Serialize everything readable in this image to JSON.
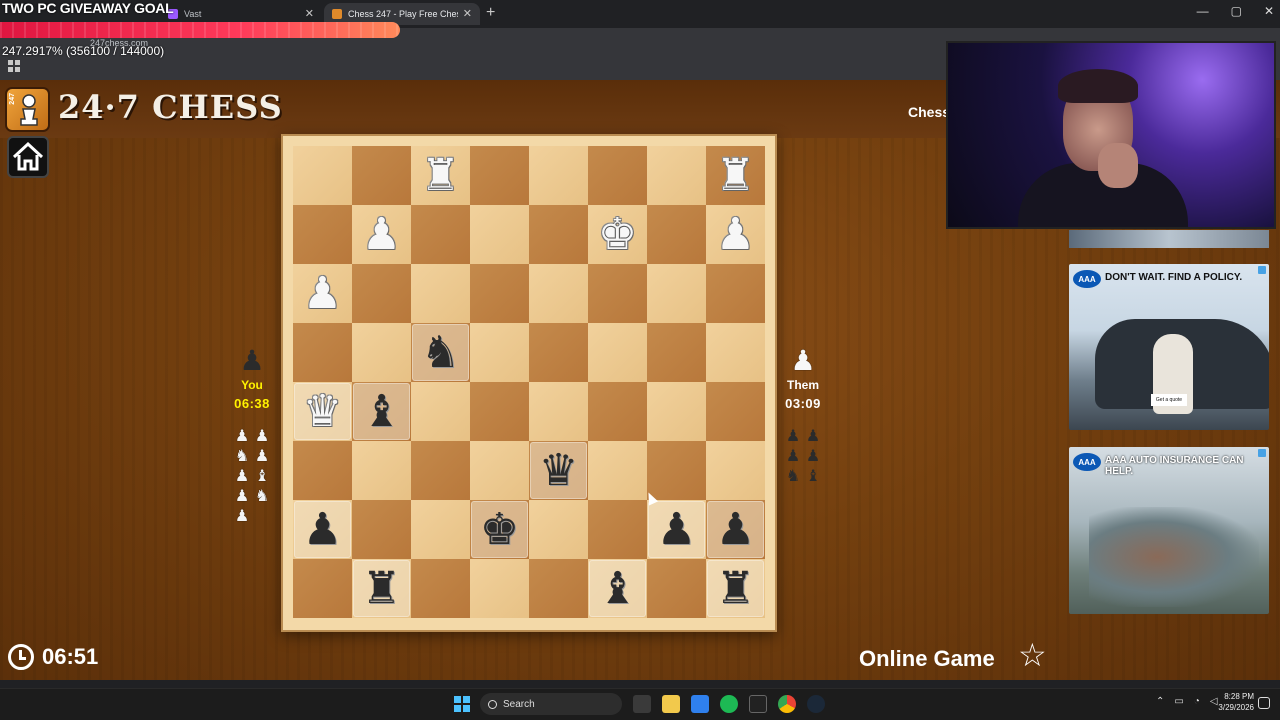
{
  "browser": {
    "tabs": [
      {
        "label": "Vast",
        "active": false
      },
      {
        "label": "Chess 247 - Play Free Chess",
        "active": false
      }
    ],
    "new_tab_label": "+",
    "url": "247chess.com",
    "window_controls": [
      "—",
      "▢",
      "✕"
    ]
  },
  "stream_overlay": {
    "goal_title": "TWO PC GIVEAWAY GOAL",
    "goal_progress": "247.2917% (356100 / 144000)",
    "goal_fraction": 2.472917
  },
  "site": {
    "title": "24·7 CHESS",
    "logo_badge": "247",
    "header_link": "Chess"
  },
  "board": {
    "pieces": [
      [
        "",
        "",
        "♜",
        "",
        "",
        "",
        "",
        "♜"
      ],
      [
        "",
        "♟",
        "",
        "",
        "",
        "♚",
        "",
        "♟"
      ],
      [
        "♟",
        "",
        "",
        "",
        "",
        "",
        "",
        ""
      ],
      [
        "",
        "",
        "♞",
        "",
        "",
        "",
        "",
        ""
      ],
      [
        "♛",
        "♝",
        "",
        "",
        "",
        "",
        "",
        ""
      ],
      [
        "",
        "",
        "",
        "",
        "♛",
        "",
        "",
        ""
      ],
      [
        "♟",
        "",
        "",
        "♚",
        "",
        "",
        "♟",
        "♟"
      ],
      [
        "",
        "♜",
        "",
        "",
        "",
        "♝",
        "",
        "♜"
      ]
    ],
    "colors": [
      [
        "",
        "",
        "w",
        "",
        "",
        "",
        "",
        "w"
      ],
      [
        "",
        "w",
        "",
        "",
        "",
        "w",
        "",
        "w"
      ],
      [
        "w",
        "",
        "",
        "",
        "",
        "",
        "",
        ""
      ],
      [
        "",
        "",
        "b",
        "",
        "",
        "",
        "",
        ""
      ],
      [
        "w",
        "b",
        "",
        "",
        "",
        "",
        "",
        ""
      ],
      [
        "",
        "",
        "",
        "",
        "b",
        "",
        "",
        ""
      ],
      [
        "b",
        "",
        "",
        "b",
        "",
        "",
        "b",
        "b"
      ],
      [
        "",
        "b",
        "",
        "",
        "",
        "b",
        "",
        "b"
      ]
    ],
    "highlighted": [
      [
        3,
        2
      ],
      [
        4,
        0
      ],
      [
        4,
        1
      ],
      [
        5,
        4
      ],
      [
        6,
        0
      ],
      [
        6,
        3
      ],
      [
        6,
        6
      ],
      [
        6,
        7
      ],
      [
        7,
        1
      ],
      [
        7,
        5
      ],
      [
        7,
        7
      ]
    ]
  },
  "players": {
    "you": {
      "label": "You",
      "clock": "06:38",
      "avatar": "♟"
    },
    "them": {
      "label": "Them",
      "clock": "03:09",
      "avatar": "♟"
    }
  },
  "captured": {
    "by_you": [
      "♟",
      "♟",
      "♞",
      "♟",
      "♟",
      "♝",
      "♟",
      "♞",
      "♟"
    ],
    "by_them": [
      "♟",
      "♟",
      "♟",
      "♟",
      "♞",
      "♝"
    ]
  },
  "footer": {
    "game_timer": "06:51",
    "mode_label": "Online Game",
    "favorite_icon": "☆"
  },
  "ads": {
    "ad1": {
      "brand": "AAA",
      "headline": "DON'T WAIT. FIND A POLICY.",
      "cta": "Get a quote"
    },
    "ad2": {
      "brand": "AAA",
      "headline": "AAA AUTO INSURANCE CAN HELP."
    }
  },
  "taskbar": {
    "search_placeholder": "Search",
    "time": "8:28 PM",
    "date": "3/29/2026"
  },
  "colors": {
    "accent_yellow": "#fff200",
    "board_light": "#f1d19c",
    "board_dark": "#c48a4c",
    "background_wood": "#74400f"
  }
}
